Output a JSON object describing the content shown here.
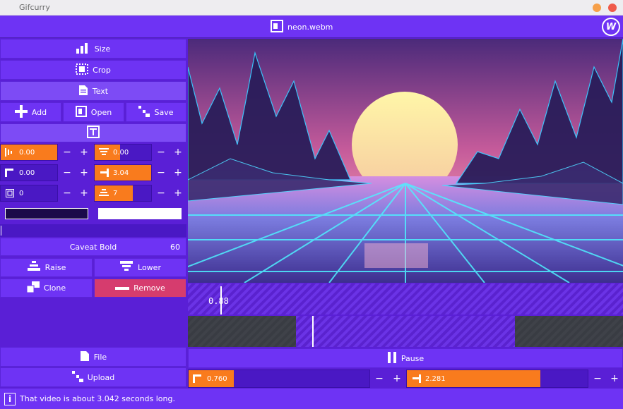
{
  "window": {
    "title": "Gifcurry"
  },
  "topbar": {
    "file_name": "neon.webm",
    "logo": "W"
  },
  "menu": {
    "size": "Size",
    "crop": "Crop",
    "text": "Text"
  },
  "actions": {
    "add": "Add",
    "open": "Open",
    "save": "Save"
  },
  "fields": {
    "x": "0.00",
    "rotation": "0.00",
    "y": "0.00",
    "end": "3.04",
    "outline": "0",
    "size": "7"
  },
  "font": {
    "name": "Caveat Bold",
    "size": "60"
  },
  "layer": {
    "raise": "Raise",
    "lower": "Lower",
    "clone": "Clone",
    "remove": "Remove"
  },
  "colors": {
    "fill": "#1b0a4a",
    "outline": "#ffffff",
    "accent": "#f97b1d",
    "primary": "#6e33f4",
    "danger": "#d63c6e"
  },
  "timeline": {
    "current": "0.88",
    "start_fraction": 0.25,
    "end_fraction": 0.75,
    "playhead_fraction": 0.29
  },
  "bottom": {
    "file": "File",
    "upload": "Upload",
    "pause": "Pause"
  },
  "trim": {
    "start": "0.760",
    "end": "2.281",
    "start_fraction": 0.25,
    "end_fraction": 0.75
  },
  "status": {
    "info_icon": "i",
    "message": "That video is about 3.042 seconds long."
  }
}
